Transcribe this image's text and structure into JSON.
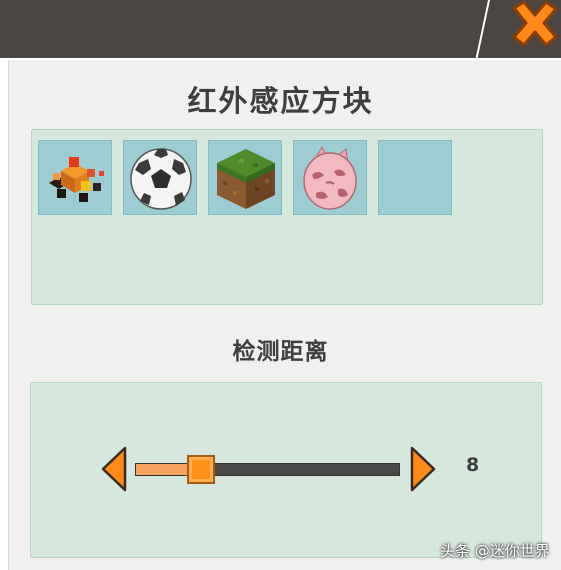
{
  "dialog": {
    "title": "红外感应方块",
    "close_icon": "close-x-icon",
    "accent_color": "#ff8a1a"
  },
  "blocks": {
    "slots": [
      {
        "icon": "fire-particle-icon"
      },
      {
        "icon": "soccer-ball-icon"
      },
      {
        "icon": "grass-block-icon"
      },
      {
        "icon": "pig-egg-icon"
      },
      {
        "icon": ""
      }
    ]
  },
  "detection_range": {
    "title": "检测距离",
    "value": "8",
    "slider_fraction": 0.25,
    "decrease_icon": "arrow-left-icon",
    "increase_icon": "arrow-right-icon"
  },
  "watermark": {
    "text": "头条 @迷你世界"
  }
}
